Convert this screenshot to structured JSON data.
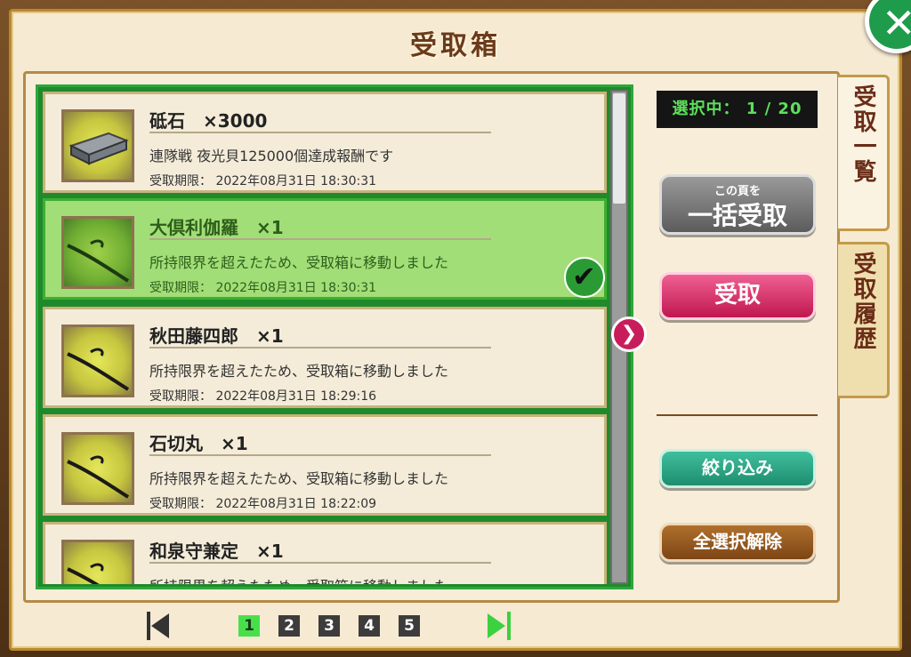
{
  "title": "受取箱",
  "close_label": "✕",
  "counter": "選択中： 1 / 20",
  "items": [
    {
      "name": "砥石　×3000",
      "desc": "連隊戦 夜光貝125000個達成報酬です",
      "date": "受取期限： 2022年08月31日 18:30:31",
      "selected": false
    },
    {
      "name": "大倶利伽羅　×1",
      "desc": "所持限界を超えたため、受取箱に移動しました",
      "date": "受取期限： 2022年08月31日 18:30:31",
      "selected": true
    },
    {
      "name": "秋田藤四郎　×1",
      "desc": "所持限界を超えたため、受取箱に移動しました",
      "date": "受取期限： 2022年08月31日 18:29:16",
      "selected": false
    },
    {
      "name": "石切丸　×1",
      "desc": "所持限界を超えたため、受取箱に移動しました",
      "date": "受取期限： 2022年08月31日 18:22:09",
      "selected": false
    },
    {
      "name": "和泉守兼定　×1",
      "desc": "所持限界を超えたため、受取箱に移動しました",
      "date": "",
      "selected": false
    }
  ],
  "buttons": {
    "bulk_small": "この頁を",
    "bulk_big": "一括受取",
    "receive": "受取",
    "filter": "絞り込み",
    "deselect_all": "全選択解除"
  },
  "tabs": {
    "list": "受取一覧",
    "history": "受取履歴"
  },
  "pager": {
    "pages": [
      "1",
      "2",
      "3",
      "4",
      "5"
    ],
    "current": "1"
  },
  "colors": {
    "selected_green": "#a2de77",
    "receive_pink": "#c0174f",
    "filter_teal": "#1e8d6e",
    "deselect_brown": "#7c4515",
    "counter_text": "#5ce05a"
  }
}
